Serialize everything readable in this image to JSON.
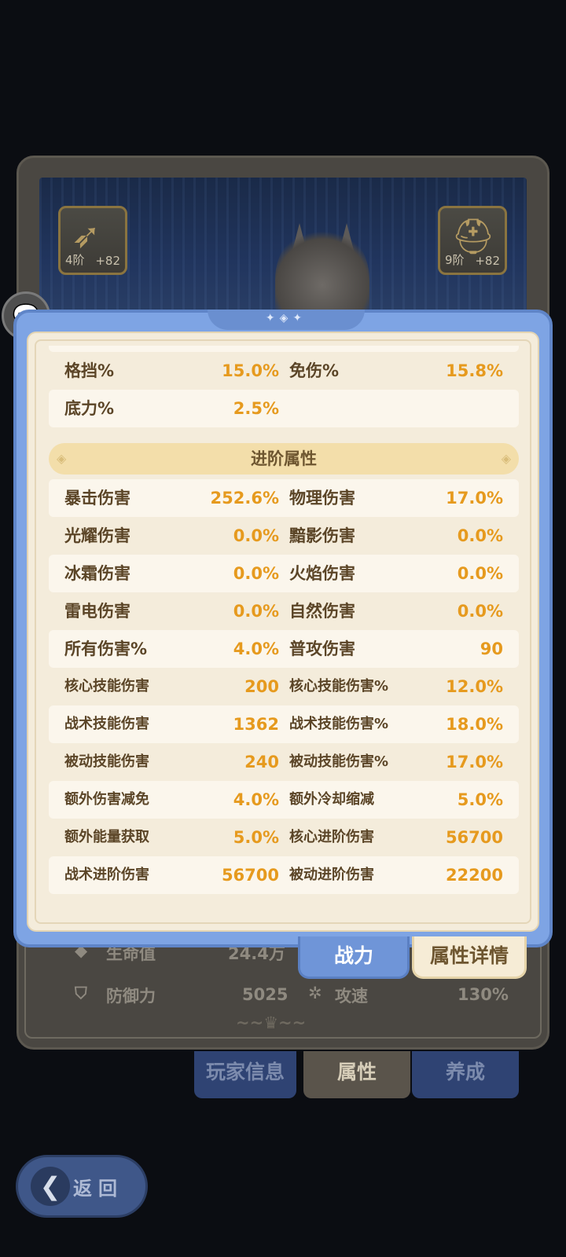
{
  "background": {
    "equip_left": {
      "icon": "bow-icon",
      "tier": "4阶",
      "plus": "+82"
    },
    "equip_right": {
      "icon": "helmet-icon",
      "tier": "9阶",
      "plus": "+82"
    },
    "stats": [
      {
        "icon": "heart-icon",
        "label": "生命值",
        "value": "24.4万"
      },
      {
        "icon": "shield-icon",
        "label": "防御力",
        "value": "5025"
      },
      {
        "icon": "speed-icon",
        "label": "攻速",
        "value": "130%"
      }
    ],
    "tabs": [
      "玩家信息",
      "属性",
      "养成"
    ],
    "back_label": "返回"
  },
  "chat_icon": "chat-bubble-icon",
  "modal": {
    "notch_glyph": "✦◈✦",
    "base_rows": [
      {
        "k1": "格挡%",
        "v1": "15.0%",
        "k2": "免伤%",
        "v2": "15.8%"
      },
      {
        "k1": "底力%",
        "v1": "2.5%",
        "k2": "",
        "v2": ""
      }
    ],
    "section_title": "进阶属性",
    "advanced_rows": [
      {
        "k1": "暴击伤害",
        "v1": "252.6%",
        "k2": "物理伤害",
        "v2": "17.0%"
      },
      {
        "k1": "光耀伤害",
        "v1": "0.0%",
        "k2": "黯影伤害",
        "v2": "0.0%"
      },
      {
        "k1": "冰霜伤害",
        "v1": "0.0%",
        "k2": "火焰伤害",
        "v2": "0.0%"
      },
      {
        "k1": "雷电伤害",
        "v1": "0.0%",
        "k2": "自然伤害",
        "v2": "0.0%"
      },
      {
        "k1": "所有伤害%",
        "v1": "4.0%",
        "k2": "普攻伤害",
        "v2": "90"
      },
      {
        "k1": "核心技能伤害",
        "v1": "200",
        "k2": "核心技能伤害%",
        "v2": "12.0%"
      },
      {
        "k1": "战术技能伤害",
        "v1": "1362",
        "k2": "战术技能伤害%",
        "v2": "18.0%"
      },
      {
        "k1": "被动技能伤害",
        "v1": "240",
        "k2": "被动技能伤害%",
        "v2": "17.0%"
      },
      {
        "k1": "额外伤害减免",
        "v1": "4.0%",
        "k2": "额外冷却缩减",
        "v2": "5.0%"
      },
      {
        "k1": "额外能量获取",
        "v1": "5.0%",
        "k2": "核心进阶伤害",
        "v2": "56700"
      },
      {
        "k1": "战术进阶伤害",
        "v1": "56700",
        "k2": "被动进阶伤害",
        "v2": "22200"
      }
    ],
    "tab_power": "战力",
    "tab_detail": "属性详情"
  },
  "colors": {
    "modal_blue": "#7ea4e4",
    "panel_cream": "#f4ecdb",
    "value_orange": "#e69a1e",
    "label_brown": "#5b4527"
  }
}
